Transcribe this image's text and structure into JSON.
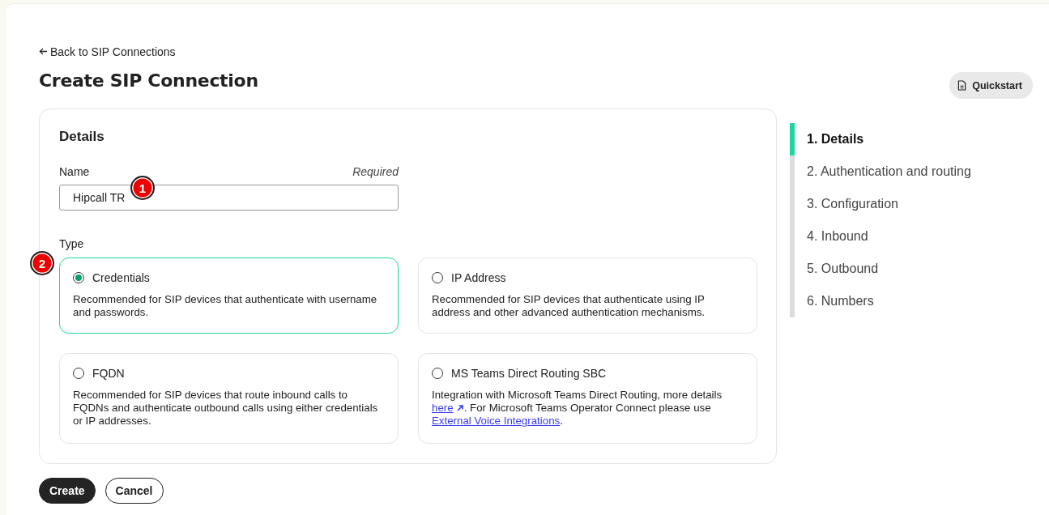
{
  "back_link": {
    "label": "Back to SIP Connections"
  },
  "title": "Create SIP Connection",
  "quickstart_button": {
    "label": "Quickstart"
  },
  "form": {
    "section_title": "Details",
    "name_field": {
      "label": "Name",
      "hint": "Required",
      "value": "Hipcall TR"
    },
    "type_label": "Type",
    "types": [
      {
        "label": "Credentials",
        "selected": true,
        "description": [
          {
            "kind": "text",
            "text": "Recommended for SIP devices that authenticate with username and passwords."
          }
        ]
      },
      {
        "label": "IP Address",
        "selected": false,
        "description": [
          {
            "kind": "text",
            "text": "Recommended for SIP devices that authenticate using IP address and other advanced authentication mechanisms."
          }
        ]
      },
      {
        "label": "FQDN",
        "selected": false,
        "description": [
          {
            "kind": "text",
            "text": "Recommended for SIP devices that route inbound calls to FQDNs and authenticate outbound calls using either credentials or IP addresses."
          }
        ]
      },
      {
        "label": "MS Teams Direct Routing SBC",
        "selected": false,
        "description": [
          {
            "kind": "text",
            "text": "Integration with Microsoft Teams Direct Routing, more details "
          },
          {
            "kind": "external_link",
            "text": "here"
          },
          {
            "kind": "text",
            "text": ". For Microsoft Teams Operator Connect please use "
          },
          {
            "kind": "link",
            "text": "External Voice Integrations"
          },
          {
            "kind": "text",
            "text": "."
          }
        ]
      }
    ]
  },
  "annotations": [
    {
      "label": "1"
    },
    {
      "label": "2"
    }
  ],
  "buttons": [
    {
      "label": "Create",
      "kind": "primary"
    },
    {
      "label": "Cancel",
      "kind": "secondary"
    }
  ],
  "steps": [
    {
      "label": "1. Details",
      "selected": true
    },
    {
      "label": "2. Authentication and routing",
      "selected": false
    },
    {
      "label": "3. Configuration",
      "selected": false
    },
    {
      "label": "4. Inbound",
      "selected": false
    },
    {
      "label": "5. Outbound",
      "selected": false
    },
    {
      "label": "6. Numbers",
      "selected": false
    }
  ]
}
